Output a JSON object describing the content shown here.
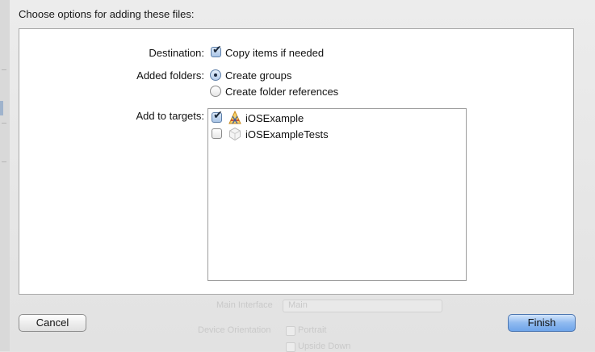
{
  "sheet": {
    "title": "Choose options for adding these files:"
  },
  "destination": {
    "label": "Destination:",
    "option": {
      "text": "Copy items if needed",
      "checked": true
    }
  },
  "added_folders": {
    "label": "Added folders:",
    "options": [
      {
        "text": "Create groups",
        "selected": true
      },
      {
        "text": "Create folder references",
        "selected": false
      }
    ]
  },
  "targets": {
    "label": "Add to targets:",
    "items": [
      {
        "name": "iOSExample",
        "checked": true,
        "icon": "app-target-icon"
      },
      {
        "name": "iOSExampleTests",
        "checked": false,
        "icon": "test-bundle-icon"
      }
    ]
  },
  "buttons": {
    "cancel": "Cancel",
    "finish": "Finish"
  },
  "background": {
    "main_interface_label": "Main Interface",
    "main_interface_value": "Main",
    "device_orientation_label": "Device Orientation",
    "portrait_label": "Portrait",
    "upside_down_label": "Upside Down"
  },
  "colors": {
    "default_button_accent": "#8fbaf0",
    "checkbox_checked": "#a9c4e6"
  }
}
